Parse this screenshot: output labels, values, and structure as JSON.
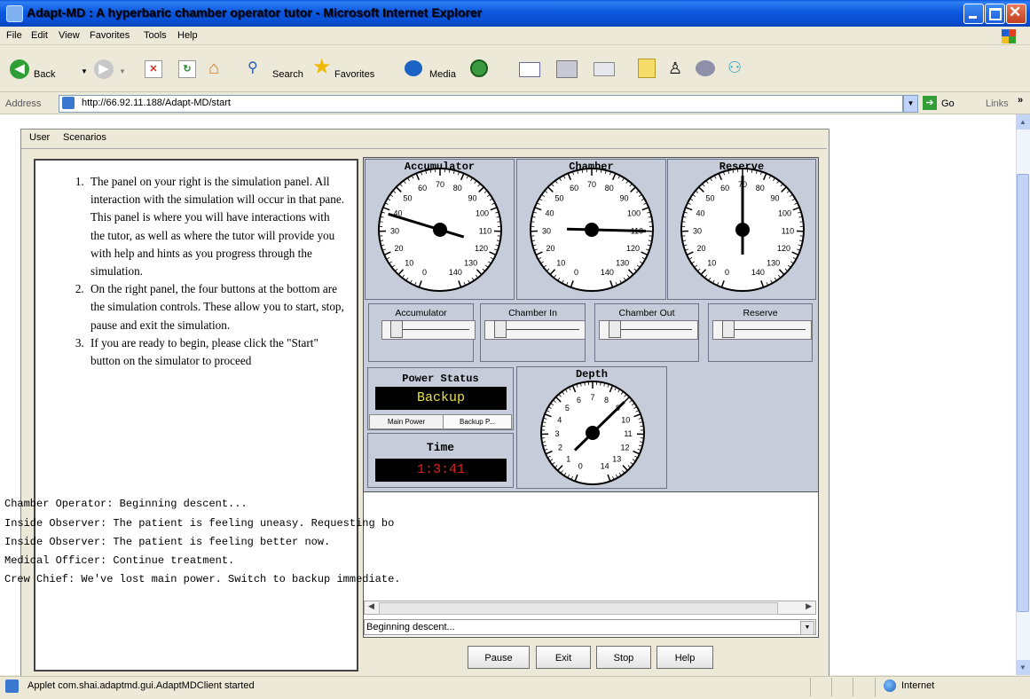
{
  "window": {
    "title": "Adapt-MD : A hyperbaric chamber operator tutor - Microsoft Internet Explorer"
  },
  "menubar": {
    "items": [
      "File",
      "Edit",
      "View",
      "Favorites",
      "Tools",
      "Help"
    ]
  },
  "toolbar": {
    "back": "Back",
    "search": "Search",
    "favorites": "Favorites",
    "media": "Media"
  },
  "address": {
    "label": "Address",
    "url": "http://66.92.11.188/Adapt-MD/start",
    "go": "Go",
    "links": "Links"
  },
  "applet": {
    "menu": [
      "User",
      "Scenarios"
    ],
    "instructions": [
      "The panel on your right is the simulation panel. All interaction with the simulation will occur in that pane. This panel is where you will have interactions with the tutor, as well as where the tutor will provide you with help and hints as you progress through the simulation.",
      "On the right panel, the four buttons at the bottom are the simulation controls. These allow you to start, stop, pause and exit the simulation.",
      "If you are ready to begin, please click the \"Start\" button on the simulator to proceed"
    ],
    "gauges": [
      {
        "title": "Accumulator",
        "needle": 38
      },
      {
        "title": "Chamber",
        "needle": 110
      },
      {
        "title": "Reserve",
        "needle": 70
      }
    ],
    "gauge_ticks": [
      "0",
      "10",
      "20",
      "30",
      "40",
      "50",
      "60",
      "70",
      "80",
      "90",
      "100",
      "110",
      "120",
      "130",
      "140"
    ],
    "sliders": [
      {
        "label": "Accumulator",
        "level": 0.1
      },
      {
        "label": "Chamber In",
        "level": 0.1
      },
      {
        "label": "Chamber Out",
        "level": 0.1
      },
      {
        "label": "Reserve",
        "level": 0.1
      }
    ],
    "power": {
      "title": "Power Status",
      "value": "Backup",
      "main_btn": "Main Power",
      "backup_btn": "Backup P..."
    },
    "time": {
      "title": "Time",
      "value": "1:3:41"
    },
    "depth": {
      "title": "Depth",
      "ticks": [
        "0",
        "1",
        "2",
        "3",
        "4",
        "5",
        "6",
        "7",
        "8",
        "9",
        "10",
        "11",
        "12",
        "13",
        "14"
      ],
      "needle": 9
    },
    "log": [
      "Chamber Operator: Beginning descent...",
      "Inside Observer:  The patient is feeling uneasy.  Requesting bo",
      "Inside Observer:  The patient is feeling better now.",
      "Medical Officer:  Continue treatment.",
      "Crew Chief:  We've lost main power.  Switch to backup immediate."
    ],
    "status_field": "Beginning descent...",
    "controls": [
      "Pause",
      "Exit",
      "Stop",
      "Help"
    ]
  },
  "statusbar": {
    "text": "Applet com.shai.adaptmd.gui.AdaptMDClient started",
    "zone": "Internet"
  },
  "colors": {
    "titlebar": "#0a4fd4",
    "lcd_power": "#e8e040",
    "lcd_time": "#e02020",
    "panel": "#c6ccd9"
  }
}
